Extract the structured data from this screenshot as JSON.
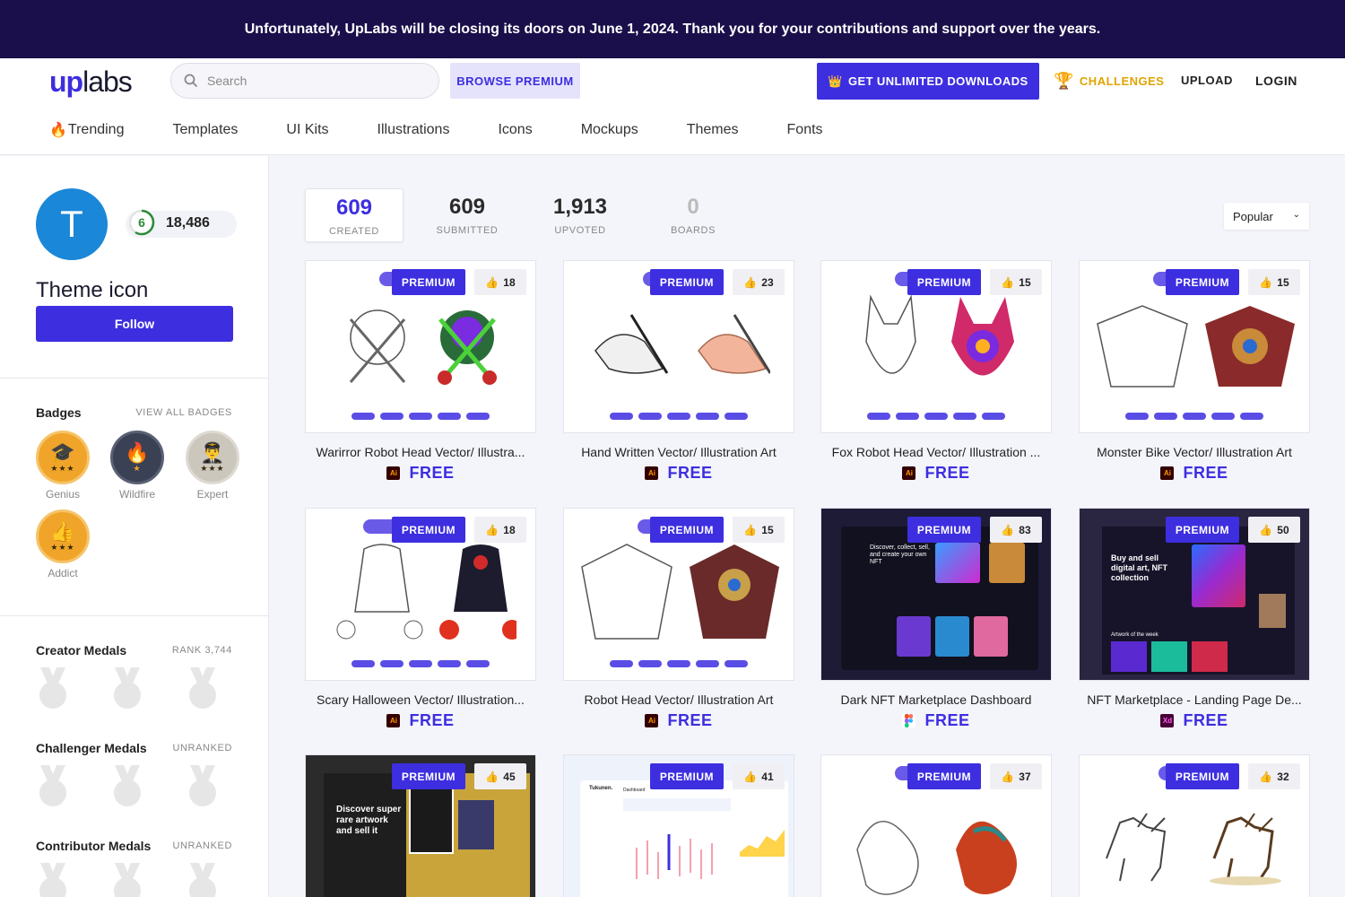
{
  "banner": {
    "text": "Unfortunately, UpLabs will be closing its doors on June 1, 2024. Thank you for your contributions and support over the years."
  },
  "header": {
    "logo_up": "up",
    "logo_labs": "labs",
    "search_placeholder": "Search",
    "browse_premium": "BROWSE PREMIUM",
    "get_unlimited": "GET UNLIMITED DOWNLOADS",
    "challenges": "CHALLENGES",
    "upload": "UPLOAD",
    "login": "LOGIN"
  },
  "nav": {
    "items": [
      "Trending",
      "Templates",
      "UI Kits",
      "Illustrations",
      "Icons",
      "Mockups",
      "Themes",
      "Fonts"
    ]
  },
  "profile": {
    "avatar_letter": "T",
    "level": "6",
    "points": "18,486",
    "name": "Theme icon",
    "follow": "Follow"
  },
  "badges": {
    "title": "Badges",
    "view_all": "VIEW ALL BADGES",
    "items": [
      {
        "label": "Genius",
        "stars": "★★★",
        "icon": "graduation-cap-icon",
        "color": "#f0a52a"
      },
      {
        "label": "Wildfire",
        "stars": "★",
        "icon": "fire-icon",
        "color": "#3b4154"
      },
      {
        "label": "Expert",
        "stars": "★★★",
        "icon": "expert-person-icon",
        "color": "#cbc7bd"
      },
      {
        "label": "Addict",
        "stars": "★★★",
        "icon": "thumbs-up-icon",
        "color": "#f0a52a"
      }
    ]
  },
  "medals": {
    "creator": {
      "title": "Creator Medals",
      "rank": "RANK 3,744"
    },
    "challenger": {
      "title": "Challenger Medals",
      "rank": "UNRANKED"
    },
    "contributor": {
      "title": "Contributor Medals",
      "rank": "UNRANKED"
    }
  },
  "stats": {
    "created": {
      "num": "609",
      "label": "CREATED"
    },
    "submitted": {
      "num": "609",
      "label": "SUBMITTED"
    },
    "upvoted": {
      "num": "1,913",
      "label": "UPVOTED"
    },
    "boards": {
      "num": "0",
      "label": "BOARDS"
    }
  },
  "sort": {
    "selected": "Popular"
  },
  "cards": [
    {
      "title": "Warirror Robot Head Vector/ Illustra...",
      "likes": "18",
      "premium": "PREMIUM",
      "price": "FREE",
      "app": "Ai"
    },
    {
      "title": "Hand Written Vector/ Illustration Art",
      "likes": "23",
      "premium": "PREMIUM",
      "price": "FREE",
      "app": "Ai"
    },
    {
      "title": "Fox Robot Head Vector/ Illustration ...",
      "likes": "15",
      "premium": "PREMIUM",
      "price": "FREE",
      "app": "Ai"
    },
    {
      "title": "Monster Bike Vector/ Illustration Art",
      "likes": "15",
      "premium": "PREMIUM",
      "price": "FREE",
      "app": "Ai"
    },
    {
      "title": "Scary Halloween Vector/ Illustration...",
      "likes": "18",
      "premium": "PREMIUM",
      "price": "FREE",
      "app": "Ai"
    },
    {
      "title": "Robot Head Vector/ Illustration Art",
      "likes": "15",
      "premium": "PREMIUM",
      "price": "FREE",
      "app": "Ai"
    },
    {
      "title": "Dark NFT Marketplace Dashboard",
      "likes": "83",
      "premium": "PREMIUM",
      "price": "FREE",
      "app": "Figma"
    },
    {
      "title": "NFT Marketplace - Landing Page De...",
      "likes": "50",
      "premium": "PREMIUM",
      "price": "FREE",
      "app": "Xd"
    },
    {
      "title": "",
      "likes": "45",
      "premium": "PREMIUM",
      "price": "",
      "app": ""
    },
    {
      "title": "",
      "likes": "41",
      "premium": "PREMIUM",
      "price": "",
      "app": ""
    },
    {
      "title": "",
      "likes": "37",
      "premium": "PREMIUM",
      "price": "",
      "app": ""
    },
    {
      "title": "",
      "likes": "32",
      "premium": "PREMIUM",
      "price": "",
      "app": ""
    }
  ],
  "thumb_text": {
    "nft1_headline": "Discover, collect, sell, and create your own NFT",
    "nft2_headline": "Buy and sell digital art, NFT collection",
    "nft2_sub": "Artwork of the week",
    "art_headline": "Discover super rare artwork and sell it",
    "dash_brand": "Tukunen.",
    "dash_title": "Dashboard"
  },
  "colors": {
    "accent": "#3d2ee0",
    "banner": "#1a0f4a",
    "challenges": "#e0a400"
  }
}
